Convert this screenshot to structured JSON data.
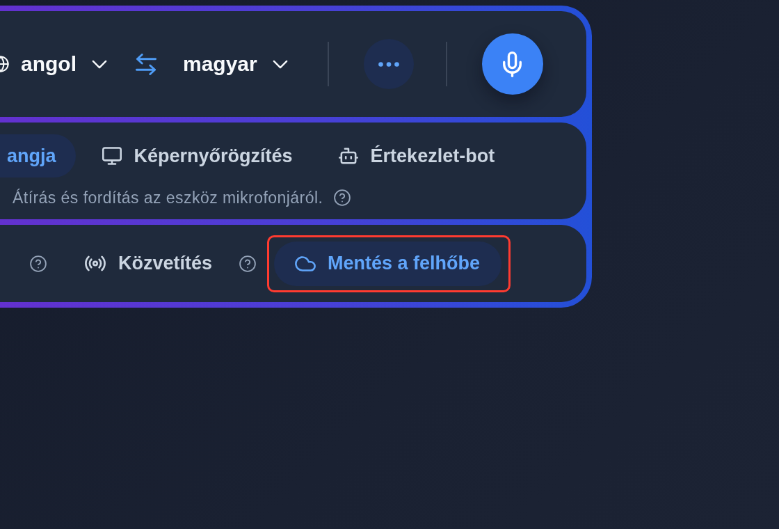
{
  "language_bar": {
    "source_language": "angol",
    "target_language": "magyar"
  },
  "source_tabs": [
    {
      "label": "angja",
      "selected": true
    },
    {
      "label": "Képernyőrögzítés",
      "selected": false
    },
    {
      "label": "Értekezlet-bot",
      "selected": false
    }
  ],
  "source_description": {
    "text": "Átírás és fordítás az eszköz mikrofonjáról.",
    "help": true
  },
  "output_options": [
    {
      "help": true
    },
    {
      "label": "Közvetítés",
      "help": true
    }
  ],
  "save_button": {
    "label": "Mentés a felhőbe",
    "highlighted": true
  }
}
